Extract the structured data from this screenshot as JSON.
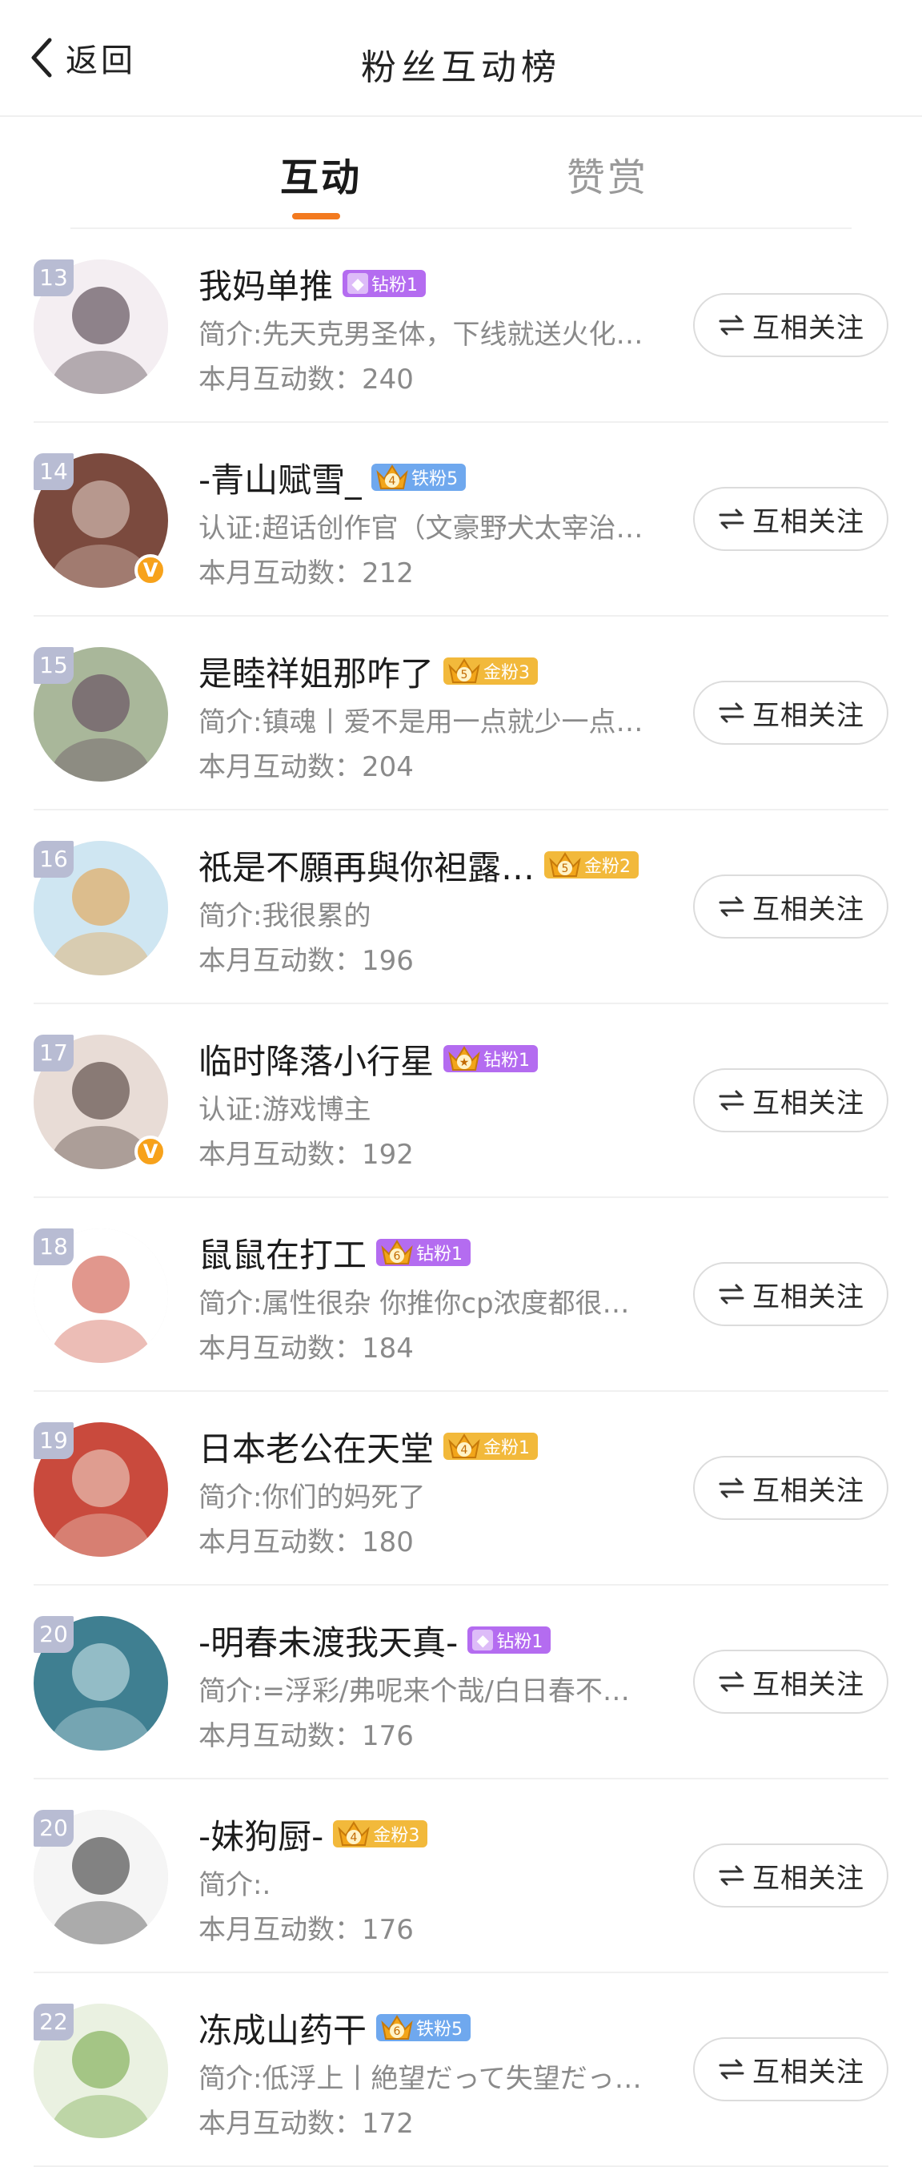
{
  "header": {
    "back_label": "返回",
    "title": "粉丝互动榜"
  },
  "tabs": [
    {
      "label": "互动"
    },
    {
      "label": "赞赏"
    }
  ],
  "colors": {
    "accent": "#f37a1f",
    "rank_bg": "#b8bcd3",
    "diamond_badge": "#b46cf0",
    "iron_badge": "#6fa8ee",
    "gold_badge": "#f2b93b",
    "verified": "#f7a21b"
  },
  "items": [
    {
      "rank": "13",
      "name": "我妈单推",
      "badge": "钻粉1",
      "badge_type": "diamond",
      "crown": "",
      "verified": false,
      "desc": "简介:先天克男圣体，下线就送火化…",
      "count": "本月互动数：240",
      "button": "互相关注",
      "avatar_bg": "#f4eef2",
      "avatar_fg": "#3a2a35"
    },
    {
      "rank": "14",
      "name": "-青山赋雪_",
      "badge": "铁粉5",
      "badge_type": "iron",
      "crown": "4",
      "verified": true,
      "desc": "认证:超话创作官（文豪野犬太宰治…",
      "count": "本月互动数：212",
      "button": "互相关注",
      "avatar_bg": "#7b4a3e",
      "avatar_fg": "#e9d8cf"
    },
    {
      "rank": "15",
      "name": "是睦祥姐那咋了",
      "badge": "金粉3",
      "badge_type": "gold",
      "crown": "5",
      "verified": false,
      "desc": "简介:镇魂丨爱不是用一点就少一点…",
      "count": "本月互动数：204",
      "button": "互相关注",
      "avatar_bg": "#a9b79a",
      "avatar_fg": "#5a3b55"
    },
    {
      "rank": "16",
      "name": "祇是不願再與你袒露…",
      "badge": "金粉2",
      "badge_type": "gold",
      "crown": "5",
      "verified": false,
      "desc": "简介:我很累的",
      "count": "本月互动数：196",
      "button": "互相关注",
      "avatar_bg": "#cfe6f2",
      "avatar_fg": "#e89a3a"
    },
    {
      "rank": "17",
      "name": "临时降落小行星",
      "badge": "钻粉1",
      "badge_type": "diamond",
      "crown": "★",
      "verified": true,
      "desc": "认证:游戏博主",
      "count": "本月互动数：192",
      "button": "互相关注",
      "avatar_bg": "#e8dcd6",
      "avatar_fg": "#3b2a26"
    },
    {
      "rank": "18",
      "name": "鼠鼠在打工",
      "badge": "钻粉1",
      "badge_type": "diamond",
      "crown": "6",
      "verified": false,
      "desc": "简介:属性很杂 你推你cp浓度都很…",
      "count": "本月互动数：184",
      "button": "互相关注",
      "avatar_bg": "#ffffff",
      "avatar_fg": "#c8412f"
    },
    {
      "rank": "19",
      "name": "日本老公在天堂",
      "badge": "金粉1",
      "badge_type": "gold",
      "crown": "4",
      "verified": false,
      "desc": "简介:你们的妈死了",
      "count": "本月互动数：180",
      "button": "互相关注",
      "avatar_bg": "#c94a3d",
      "avatar_fg": "#f1e1d6"
    },
    {
      "rank": "20",
      "name": "-明春未渡我天真-",
      "badge": "钻粉1",
      "badge_type": "diamond",
      "crown": "",
      "verified": false,
      "desc": "简介:=浮彩/弗呢来个哉/白日春不…",
      "count": "本月互动数：176",
      "button": "互相关注",
      "avatar_bg": "#3f7f91",
      "avatar_fg": "#d9eef2"
    },
    {
      "rank": "20",
      "name": "-妹狗厨-",
      "badge": "金粉3",
      "badge_type": "gold",
      "crown": "4",
      "verified": false,
      "desc": "简介:.",
      "count": "本月互动数：176",
      "button": "互相关注",
      "avatar_bg": "#f5f5f5",
      "avatar_fg": "#222222"
    },
    {
      "rank": "22",
      "name": "冻成山药干",
      "badge": "铁粉5",
      "badge_type": "iron",
      "crown": "6",
      "verified": false,
      "desc": "简介:低浮上丨絶望だって失望だっ…",
      "count": "本月互动数：172",
      "button": "互相关注",
      "avatar_bg": "#eaf1e1",
      "avatar_fg": "#6aa03a"
    }
  ]
}
